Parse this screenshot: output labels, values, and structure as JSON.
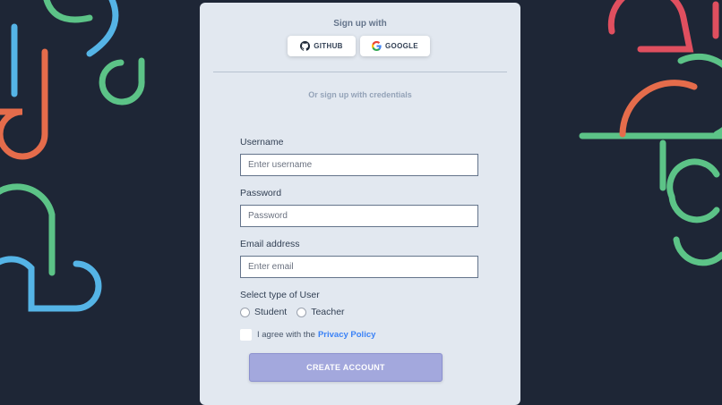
{
  "colors": {
    "background": "#1e2636",
    "card": "#e2e8f0",
    "accent_blue": "#55b4e6",
    "accent_green": "#5cc387",
    "accent_orange": "#e56c4b",
    "accent_red": "#e04f5f",
    "button": "#a3a8dd",
    "link": "#3b82f6"
  },
  "signup": {
    "title": "Sign up with",
    "github_label": "GITHUB",
    "google_label": "GOOGLE",
    "github_icon": "github-icon",
    "google_icon": "google-icon",
    "or_text": "Or sign up with credentials"
  },
  "form": {
    "username_label": "Username",
    "username_placeholder": "Enter username",
    "password_label": "Password",
    "password_placeholder": "Password",
    "email_label": "Email address",
    "email_placeholder": "Enter email",
    "user_type_label": "Select type of User",
    "user_types": [
      "Student",
      "Teacher"
    ],
    "agree_text": "I agree with the",
    "privacy_link": "Privacy Policy",
    "submit_label": "CREATE ACCOUNT"
  }
}
